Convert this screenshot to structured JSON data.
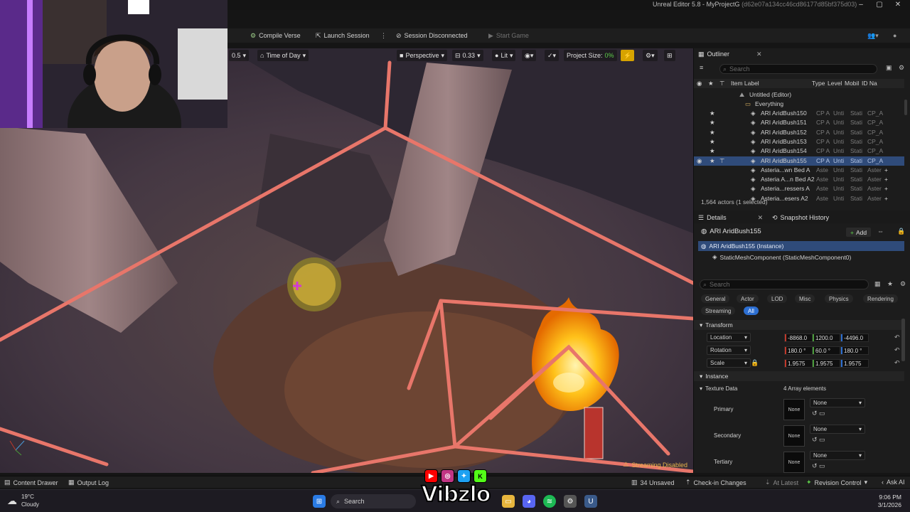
{
  "window": {
    "title": "Unreal Editor 5.8 - MyProjectG",
    "hash": "(d62e07a134cc46cd86177d85bf375d03)",
    "controls": [
      "–",
      "▢",
      "✕"
    ]
  },
  "toolbar": {
    "compile_verse": "Compile Verse",
    "launch_session": "Launch Session",
    "session_status": "Session Disconnected",
    "start_game": "Start Game"
  },
  "viewport": {
    "speed": "0.5",
    "time_of_day": "Time of Day",
    "perspective": "Perspective",
    "fov": "0.33",
    "lit": "Lit",
    "project_size_label": "Project Size:",
    "project_size_value": "0%",
    "streaming_status": "Streaming Disabled"
  },
  "outliner": {
    "tab": "Outliner",
    "search_placeholder": "Search",
    "col_label": "Item Label",
    "col_type": "Type",
    "col_level": "Level",
    "col_mobil": "Mobil",
    "col_id": "ID Na",
    "root": "Untitled (Editor)",
    "folder": "Everything",
    "rows": [
      {
        "label": "ARI AridBush150",
        "type": "CP A",
        "level": "Unti",
        "mob": "Stati",
        "id": "CP_A"
      },
      {
        "label": "ARI AridBush151",
        "type": "CP A",
        "level": "Unti",
        "mob": "Stati",
        "id": "CP_A"
      },
      {
        "label": "ARI AridBush152",
        "type": "CP A",
        "level": "Unti",
        "mob": "Stati",
        "id": "CP_A"
      },
      {
        "label": "ARI AridBush153",
        "type": "CP A",
        "level": "Unti",
        "mob": "Stati",
        "id": "CP_A"
      },
      {
        "label": "ARI AridBush154",
        "type": "CP A",
        "level": "Unti",
        "mob": "Stati",
        "id": "CP_A"
      },
      {
        "label": "ARI AridBush155",
        "type": "CP A",
        "level": "Unti",
        "mob": "Stati",
        "id": "CP_A"
      },
      {
        "label": "Asteria...wn Bed A",
        "type": "Aste",
        "level": "Unti",
        "mob": "Stati",
        "id": "Aster"
      },
      {
        "label": "Asteria A...n Bed A2",
        "type": "Aste",
        "level": "Unti",
        "mob": "Stati",
        "id": "Aster"
      },
      {
        "label": "Asteria...ressers A",
        "type": "Aste",
        "level": "Unti",
        "mob": "Stati",
        "id": "Aster"
      },
      {
        "label": "Asteria...esers A2",
        "type": "Aste",
        "level": "Unti",
        "mob": "Stati",
        "id": "Aster"
      }
    ],
    "footer": "1,564 actors (1 selected)"
  },
  "details": {
    "tab": "Details",
    "snapshot_tab": "Snapshot History",
    "actor_name": "ARI AridBush155",
    "add_label": "Add",
    "instance_component": "ARI AridBush155 (Instance)",
    "mesh_component": "StaticMeshComponent (StaticMeshComponent0)",
    "search_placeholder": "Search",
    "categories": [
      "General",
      "Actor",
      "LOD",
      "Misc",
      "Physics",
      "Rendering",
      "Streaming",
      "All"
    ],
    "transform_title": "Transform",
    "location_label": "Location",
    "location": [
      "-8868.0",
      "1200.0",
      "-4496.0"
    ],
    "rotation_label": "Rotation",
    "rotation": [
      "180.0 °",
      "60.0 °",
      "180.0 °"
    ],
    "scale_label": "Scale",
    "scale": [
      "1.9575",
      "1.9575",
      "1.9575"
    ],
    "instance_title": "Instance",
    "texture_data": "Texture Data",
    "array_elements": "4 Array elements",
    "primary": "Primary",
    "secondary": "Secondary",
    "tertiary": "Tertiary",
    "none": "None"
  },
  "statusbar": {
    "content_drawer": "Content Drawer",
    "output_log": "Output Log",
    "unsaved": "34 Unsaved",
    "check_in": "Check-in Changes",
    "at_latest": "At Latest",
    "revision_control": "Revision Control",
    "ask_ai": "Ask AI"
  },
  "taskbar": {
    "temperature": "19°C",
    "weather": "Cloudy",
    "search": "Search",
    "time": "9:06 PM",
    "date": "3/1/2026"
  },
  "overlay": {
    "brand": "Vibzlo"
  },
  "colors": {
    "selection": "#2f4b7a",
    "accent_blue": "#2d6fd2",
    "volume_lines": "#e8766a",
    "warning": "#e8b54a"
  }
}
